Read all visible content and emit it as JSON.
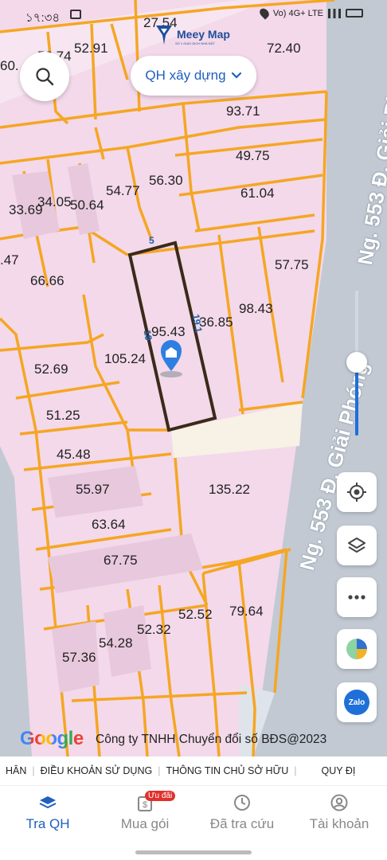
{
  "status_bar": {
    "time": "১৭:৩৪",
    "network": "Vo) 4G+ LTE"
  },
  "logo": {
    "title": "Meey Map",
    "subtitle": "SỐ 1 GIAO DỊCH NHÀ ĐẤT"
  },
  "search": {
    "icon": "search-icon"
  },
  "planning_select": {
    "label": "QH xây dựng",
    "icon": "chevron-down-icon"
  },
  "map": {
    "plots": [
      "60.",
      "52.74",
      "52.91",
      "27.54",
      "72.40",
      "93.71",
      "49.75",
      "61.04",
      "54.77",
      "56.30",
      "33.69",
      "34.05",
      "50.64",
      ".47",
      "66.66",
      "57.75",
      "95.43",
      "36.85",
      "98.43",
      "105.24",
      "52.69",
      "51.25",
      "45.48",
      "55.97",
      "63.64",
      "67.75",
      "135.22",
      "79.64",
      "52.52",
      "52.32",
      "54.28",
      "57.36"
    ],
    "dimensions": [
      "5",
      "19",
      "19.1"
    ],
    "roads": [
      "Ng. 553 Đ. Giải Phóng",
      "Ng. 553 Đ. Giải Phóng"
    ],
    "marker_icon": "home-marker-icon"
  },
  "zoom": {
    "level_fraction": 0.5
  },
  "map_buttons": {
    "locate": "crosshair-icon",
    "layers": "layers-icon",
    "more": "more-icon",
    "stats": "pie-chart-icon",
    "zalo": "Zalo"
  },
  "copyright": {
    "google": "Google",
    "text": "Công ty TNHH Chuyển đổi số BĐS@2023"
  },
  "footer_links": [
    "HÂN",
    "ĐIỀU KHOẢN SỬ DỤNG",
    "THÔNG TIN CHỦ SỞ HỮU",
    "QUY ĐỊ"
  ],
  "bottom_nav": {
    "items": [
      {
        "label": "Tra QH",
        "icon": "layers-stack-icon",
        "active": true
      },
      {
        "label": "Mua gói",
        "icon": "package-icon",
        "badge": "Ưu đãi"
      },
      {
        "label": "Đã tra cứu",
        "icon": "clock-icon"
      },
      {
        "label": "Tài khoản",
        "icon": "user-icon"
      }
    ]
  },
  "colors": {
    "plot_fill": "#f3d9ea",
    "plot_border": "#f5a623",
    "road": "#c2c9d3",
    "accent": "#1f5fbf",
    "badge": "#e0312c"
  }
}
